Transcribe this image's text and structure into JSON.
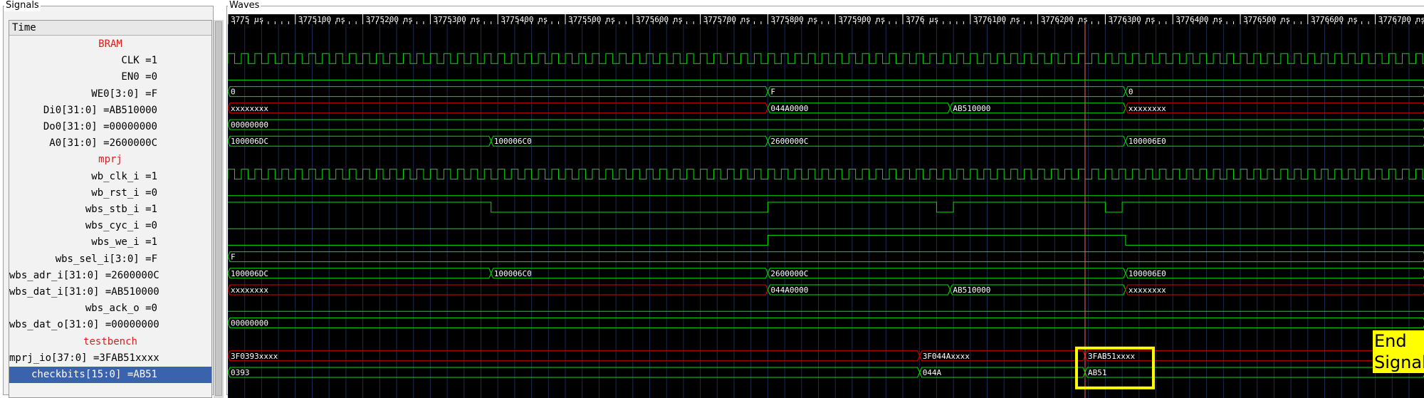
{
  "signals_panel": {
    "title": "Signals",
    "time_header": "Time",
    "rows": [
      {
        "label": "BRAM",
        "kind": "group"
      },
      {
        "label": "CLK =1",
        "kind": "signal"
      },
      {
        "label": "EN0 =0",
        "kind": "signal"
      },
      {
        "label": "WE0[3:0] =F",
        "kind": "signal"
      },
      {
        "label": "Di0[31:0] =AB510000",
        "kind": "signal"
      },
      {
        "label": "Do0[31:0] =00000000",
        "kind": "signal"
      },
      {
        "label": "A0[31:0] =2600000C",
        "kind": "signal"
      },
      {
        "label": "mprj",
        "kind": "group"
      },
      {
        "label": "wb_clk_i =1",
        "kind": "signal"
      },
      {
        "label": "wb_rst_i =0",
        "kind": "signal"
      },
      {
        "label": "wbs_stb_i =1",
        "kind": "signal"
      },
      {
        "label": "wbs_cyc_i =0",
        "kind": "signal"
      },
      {
        "label": "wbs_we_i =1",
        "kind": "signal"
      },
      {
        "label": "wbs_sel_i[3:0] =F",
        "kind": "signal"
      },
      {
        "label": "wbs_adr_i[31:0] =2600000C",
        "kind": "signal"
      },
      {
        "label": "wbs_dat_i[31:0] =AB510000",
        "kind": "signal"
      },
      {
        "label": "wbs_ack_o =0",
        "kind": "signal"
      },
      {
        "label": "wbs_dat_o[31:0] =00000000",
        "kind": "signal"
      },
      {
        "label": "testbench",
        "kind": "group"
      },
      {
        "label": "mprj_io[37:0] =3FAB51xxxx",
        "kind": "signal"
      },
      {
        "label": "checkbits[15:0] =AB51",
        "kind": "signal",
        "selected": true
      }
    ]
  },
  "waves_panel": {
    "title": "Waves",
    "ruler": {
      "start": 3775000,
      "end": 3776800,
      "labels": [
        {
          "t": 3775000,
          "text": "3775 us"
        },
        {
          "t": 3775100,
          "text": "3775100 ns"
        },
        {
          "t": 3775200,
          "text": "3775200 ns"
        },
        {
          "t": 3775300,
          "text": "3775300 ns"
        },
        {
          "t": 3775400,
          "text": "3775400 ns"
        },
        {
          "t": 3775500,
          "text": "3775500 ns"
        },
        {
          "t": 3775600,
          "text": "3775600 ns"
        },
        {
          "t": 3775700,
          "text": "3775700 ns"
        },
        {
          "t": 3775800,
          "text": "3775800 ns"
        },
        {
          "t": 3775900,
          "text": "3775900 ns"
        },
        {
          "t": 3776000,
          "text": "3776 us"
        },
        {
          "t": 3776100,
          "text": "3776100 ns"
        },
        {
          "t": 3776200,
          "text": "3776200 ns"
        },
        {
          "t": 3776300,
          "text": "3776300 ns"
        },
        {
          "t": 3776400,
          "text": "3776400 ns"
        },
        {
          "t": 3776500,
          "text": "3776500 ns"
        },
        {
          "t": 3776600,
          "text": "3776600 ns"
        },
        {
          "t": 3776700,
          "text": "3776700 ns"
        }
      ]
    },
    "marker_time": 3776270,
    "traces": [
      {
        "row": 0,
        "type": "blank"
      },
      {
        "row": 1,
        "type": "clock",
        "period": 20
      },
      {
        "row": 2,
        "type": "bit",
        "initial": 0,
        "edges": []
      },
      {
        "row": 3,
        "type": "bus",
        "segments": [
          {
            "t": 3775000,
            "value": "0"
          },
          {
            "t": 3775800,
            "value": "F"
          },
          {
            "t": 3776330,
            "value": "0"
          }
        ]
      },
      {
        "row": 4,
        "type": "bus",
        "segments": [
          {
            "t": 3775000,
            "value": "xxxxxxxx",
            "x": true
          },
          {
            "t": 3775800,
            "value": "044A0000"
          },
          {
            "t": 3776070,
            "value": "AB510000"
          },
          {
            "t": 3776330,
            "value": "xxxxxxxx",
            "x": true
          }
        ]
      },
      {
        "row": 5,
        "type": "bus",
        "segments": [
          {
            "t": 3775000,
            "value": "00000000"
          }
        ]
      },
      {
        "row": 6,
        "type": "bus",
        "segments": [
          {
            "t": 3775000,
            "value": "100006DC"
          },
          {
            "t": 3775390,
            "value": "100006C0"
          },
          {
            "t": 3775800,
            "value": "2600000C"
          },
          {
            "t": 3776330,
            "value": "100006E0"
          }
        ]
      },
      {
        "row": 7,
        "type": "blank"
      },
      {
        "row": 8,
        "type": "clock",
        "period": 20
      },
      {
        "row": 9,
        "type": "bit",
        "initial": 0,
        "edges": []
      },
      {
        "row": 10,
        "type": "bit",
        "initial": 1,
        "edges": [
          3775390,
          3775800,
          3776050,
          3776075,
          3776300,
          3776325
        ]
      },
      {
        "row": 11,
        "type": "bit",
        "initial": 0,
        "edges": []
      },
      {
        "row": 12,
        "type": "bit",
        "initial": 0,
        "edges": [
          3775800,
          3776330
        ]
      },
      {
        "row": 13,
        "type": "bus",
        "segments": [
          {
            "t": 3775000,
            "value": "F"
          }
        ]
      },
      {
        "row": 14,
        "type": "bus",
        "segments": [
          {
            "t": 3775000,
            "value": "100006DC"
          },
          {
            "t": 3775390,
            "value": "100006C0"
          },
          {
            "t": 3775800,
            "value": "2600000C"
          },
          {
            "t": 3776330,
            "value": "100006E0"
          }
        ]
      },
      {
        "row": 15,
        "type": "bus",
        "segments": [
          {
            "t": 3775000,
            "value": "xxxxxxxx",
            "x": true
          },
          {
            "t": 3775800,
            "value": "044A0000"
          },
          {
            "t": 3776070,
            "value": "AB510000"
          },
          {
            "t": 3776330,
            "value": "xxxxxxxx",
            "x": true
          }
        ]
      },
      {
        "row": 16,
        "type": "bit",
        "initial": 0,
        "edges": []
      },
      {
        "row": 17,
        "type": "bus",
        "segments": [
          {
            "t": 3775000,
            "value": "00000000"
          }
        ]
      },
      {
        "row": 18,
        "type": "blank"
      },
      {
        "row": 19,
        "type": "bus",
        "segments": [
          {
            "t": 3775000,
            "value": "3F0393xxxx",
            "x": true
          },
          {
            "t": 3776025,
            "value": "3F044Axxxx",
            "x": true
          },
          {
            "t": 3776270,
            "value": "3FAB51xxxx",
            "x": true
          }
        ]
      },
      {
        "row": 20,
        "type": "bus",
        "segments": [
          {
            "t": 3775000,
            "value": "0393"
          },
          {
            "t": 3776025,
            "value": "044A"
          },
          {
            "t": 3776270,
            "value": "AB51"
          }
        ]
      }
    ],
    "annotation": {
      "label": "End Signal",
      "box_color": "#ffff00"
    }
  },
  "colors": {
    "wave": "#00e000",
    "x_wave": "#e00000",
    "marker": "#ff6060",
    "group_label": "#d62020",
    "selection": "#3a62ad"
  }
}
